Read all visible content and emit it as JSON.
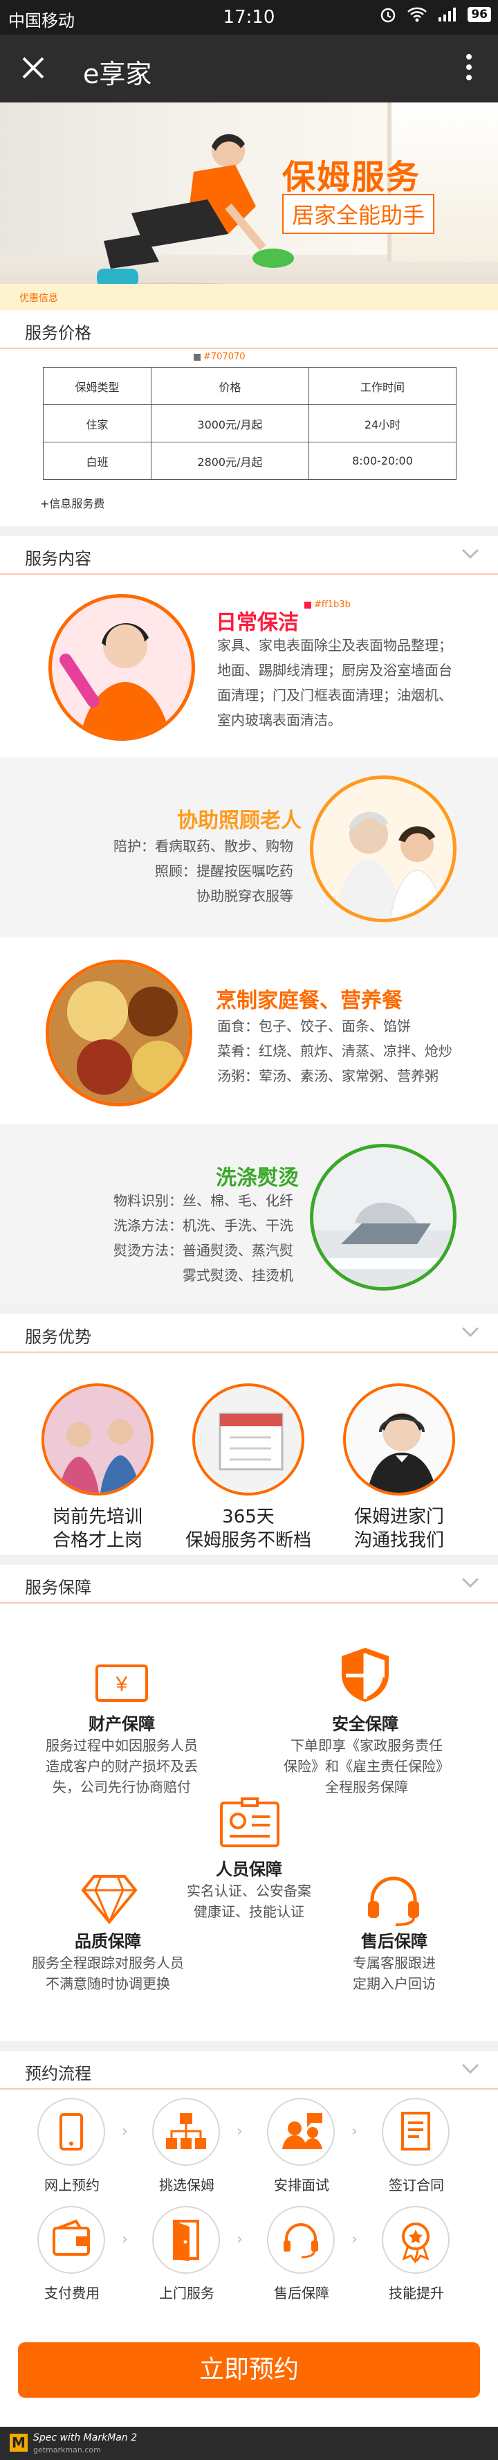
{
  "status_bar": {
    "carrier": "中国移动",
    "time": "17:10",
    "battery": "96"
  },
  "nav": {
    "title": "e享家"
  },
  "banner": {
    "title": "保姆服务",
    "subtitle": "居家全能助手",
    "discount_bar": "优惠信息"
  },
  "price": {
    "heading": "服务价格",
    "annotation": "#707070",
    "columns": [
      "保姆类型",
      "价格",
      "工作时间"
    ],
    "rows": [
      [
        "住家",
        "3000元/月起",
        "24小时"
      ],
      [
        "白班",
        "2800元/月起",
        "8:00-20:00"
      ]
    ],
    "note": "+信息服务费"
  },
  "content": {
    "heading": "服务内容",
    "annotation": "#ff1b3b",
    "items": [
      {
        "title": "日常保洁",
        "lines": [
          "家具、家电表面除尘及表面物品整理；",
          "地面、踢脚线清理；厨房及浴室墙面台",
          "面清理；门及门框表面清理；油烟机、",
          "室内玻璃表面清洁。"
        ]
      },
      {
        "title": "协助照顾老人",
        "lines": [
          "陪护：看病取药、散步、购物",
          "照顾：提醒按医嘱吃药",
          "协助脱穿衣服等"
        ]
      },
      {
        "title": "烹制家庭餐、营养餐",
        "lines": [
          "面食：包子、饺子、面条、馅饼",
          "菜肴：红烧、煎炸、清蒸、凉拌、炝炒",
          "汤粥：荤汤、素汤、家常粥、营养粥"
        ]
      },
      {
        "title": "洗涤熨烫",
        "lines": [
          "物料识别：丝、棉、毛、化纤",
          "洗涤方法：机洗、手洗、干洗",
          "熨烫方法：普通熨烫、蒸汽熨",
          "雾式熨烫、挂烫机"
        ]
      }
    ]
  },
  "advantages": {
    "heading": "服务优势",
    "items": [
      {
        "line1": "岗前先培训",
        "line2": "合格才上岗"
      },
      {
        "line1": "365天",
        "line2": "保姆服务不断档"
      },
      {
        "line1": "保姆进家门",
        "line2": "沟通找我们"
      }
    ]
  },
  "guarantee": {
    "heading": "服务保障",
    "items": [
      {
        "title": "财产保障",
        "lines": [
          "服务过程中如因服务人员",
          "造成客户的财产损坏及丢",
          "失，公司先行协商赔付"
        ]
      },
      {
        "title": "安全保障",
        "lines": [
          "下单即享《家政服务责任",
          "保险》和《雇主责任保险》",
          "全程服务保障"
        ]
      },
      {
        "title": "人员保障",
        "lines": [
          "实名认证、公安备案",
          "健康证、技能认证"
        ]
      },
      {
        "title": "品质保障",
        "lines": [
          "服务全程跟踪对服务人员",
          "不满意随时协调更换"
        ]
      },
      {
        "title": "售后保障",
        "lines": [
          "专属客服跟进",
          "定期入户回访"
        ]
      }
    ]
  },
  "process": {
    "heading": "预约流程",
    "steps": [
      "网上预约",
      "挑选保姆",
      "安排面试",
      "签订合同",
      "支付费用",
      "上门服务",
      "售后保障",
      "技能提升"
    ]
  },
  "cta": {
    "label": "立即预约"
  },
  "footer": {
    "logo": "M",
    "line1": "Spec with MarkMan 2",
    "line2": "getmarkman.com"
  },
  "colors": {
    "accent": "#ff6a00",
    "red": "#ff1b3b",
    "green": "#3aa829",
    "divider": "#ffc9b1"
  }
}
